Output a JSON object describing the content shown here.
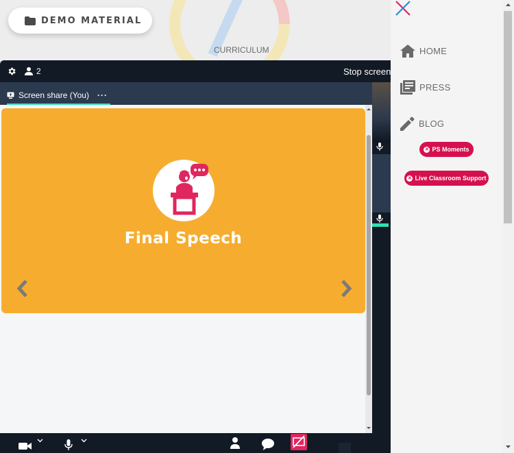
{
  "page": {
    "demo_button_label": "DEMO MATERIAL",
    "curriculum_label": "CURRICULUM"
  },
  "call": {
    "participant_count": "2",
    "stop_label": "Stop screen",
    "tab_label": "Screen share (You)",
    "tab_more": "···",
    "slide_title": "Final Speech",
    "slide_color": "#f6ad2f",
    "accent_color": "#2fe0b6"
  },
  "menu": {
    "items": [
      {
        "label": "HOME",
        "icon": "home-icon"
      },
      {
        "label": "PRESS",
        "icon": "newspaper-icon"
      },
      {
        "label": "BLOG",
        "icon": "pencil-icon"
      }
    ],
    "pills": [
      {
        "label": "PS Moments",
        "color": "#d6104f"
      },
      {
        "label": "Live Classroom Support",
        "color": "#d6104f"
      }
    ]
  }
}
